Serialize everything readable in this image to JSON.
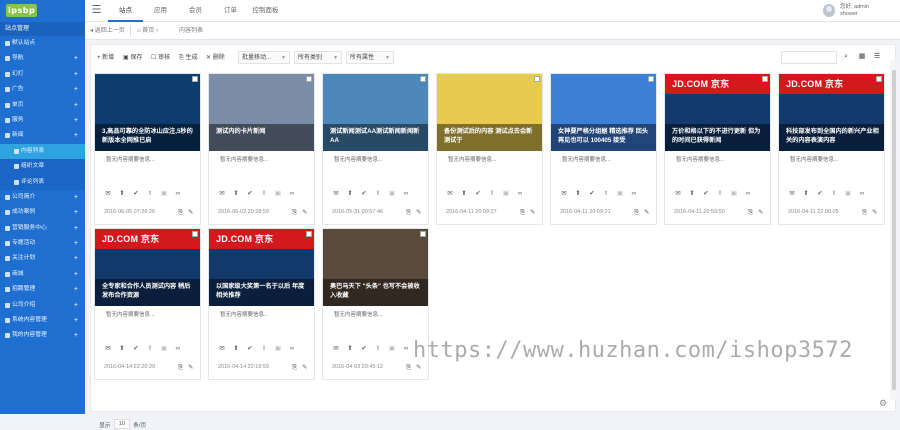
{
  "header": {
    "logo_text": "ipsbp",
    "nav": [
      "站点",
      "应用",
      "会员",
      "订单",
      "控制面板"
    ],
    "user_name": "您好, admin",
    "user_role": "shower"
  },
  "sidebar": {
    "title": "站点管理",
    "items": [
      {
        "label": "默认站点",
        "level": "top"
      },
      {
        "label": "导航",
        "plus": "+"
      },
      {
        "label": "幻灯",
        "plus": "+"
      },
      {
        "label": "广告",
        "plus": "+"
      },
      {
        "label": "单页",
        "plus": "+"
      },
      {
        "label": "服务",
        "plus": "+"
      },
      {
        "label": "新闻",
        "plus": "+"
      },
      {
        "label": "内容列表",
        "level": "sub",
        "active": true
      },
      {
        "label": "组织文章",
        "level": "sub"
      },
      {
        "label": "评论列表",
        "level": "sub"
      },
      {
        "label": "公司简介",
        "plus": "+"
      },
      {
        "label": "成功案例",
        "plus": "+"
      },
      {
        "label": "营销服务中心",
        "plus": "+"
      },
      {
        "label": "专题活动",
        "plus": "+"
      },
      {
        "label": "关注计划",
        "plus": "+"
      },
      {
        "label": "商城",
        "plus": "+"
      },
      {
        "label": "招聘管理",
        "plus": "+"
      },
      {
        "label": "公司介绍",
        "plus": "+"
      },
      {
        "label": "系统内容管理",
        "plus": "+"
      },
      {
        "label": "我的内容管理",
        "plus": "+"
      }
    ]
  },
  "breadcrumb": {
    "back": "返回上一页",
    "home": "首页",
    "current": "内容列表"
  },
  "toolbar": {
    "new": "新增",
    "save": "保存",
    "audit": "审核",
    "generate": "生成",
    "delete": "删除",
    "batch": "批量移动...",
    "category": "所有类别",
    "attribute": "所有属性"
  },
  "cards": [
    {
      "title": "3,高品可靠的全防冰山应注,5秒的新版本全网推已启",
      "desc": "暂无内容摘要信息...",
      "date": "2016-06-05 07:26:26",
      "bg": "#0d3c6e",
      "jd": false
    },
    {
      "title": "测试内的卡片新闻",
      "desc": "暂无内容摘要信息...",
      "date": "2016-06-02 20:28:59",
      "bg": "#7a8da4",
      "jd": false
    },
    {
      "title": "测试新闻测试AA测试新闻新闻新AA",
      "desc": "暂无内容摘要信息...",
      "date": "2016-05-31 00:57:46",
      "bg": "#4c87b9",
      "jd": false
    },
    {
      "title": "备份测试后的内容 测试点去会新测试于",
      "desc": "暂无内容摘要信息...",
      "date": "2016-04-11 20:09:27",
      "bg": "#e7cb4f",
      "jd": false
    },
    {
      "title": "女神要严格分组据 精选推荐 回头再见也可以 100405 接受",
      "desc": "暂无内容摘要信息...",
      "date": "2016-04-11 20:09:21",
      "bg": "#3c7fd7",
      "jd": false
    },
    {
      "title": "万价和格以下的不进行更新 但为的时间已获得新闻",
      "desc": "暂无内容摘要信息...",
      "date": "2016-04-11 20:59:50",
      "bg": "#133a6c",
      "jd": true
    },
    {
      "title": "科技部发布到全国内的新兴产业相关的内容表演内容",
      "desc": "暂无内容摘要信息...",
      "date": "2016-04-11 22:00:05",
      "bg": "#133a6c",
      "jd": true
    },
    {
      "title": "全专家和合作人员测试内容 稍后发布合作资源",
      "desc": "暂无内容摘要信息...",
      "date": "2016-04-14 22:20:29",
      "bg": "#133a6c",
      "jd": true
    },
    {
      "title": "以国家级大奖第一名于以后 年度相关推荐",
      "desc": "暂无内容摘要信息...",
      "date": "2016-04-14 22:19:59",
      "bg": "#133a6c",
      "jd": true
    },
    {
      "title": "奥巴马天下 \"头条\" 也写不会被收入收藏",
      "desc": "暂无内容摘要信息...",
      "date": "2016-04-03 20:45:12",
      "bg": "#5a4a3c",
      "jd": false
    }
  ],
  "jd_label": "JD.COM 京东",
  "pager": {
    "label_show": "显示",
    "page_size": "10",
    "label_rows": "条/页"
  },
  "watermark": "https://www.huzhan.com/ishop3572"
}
